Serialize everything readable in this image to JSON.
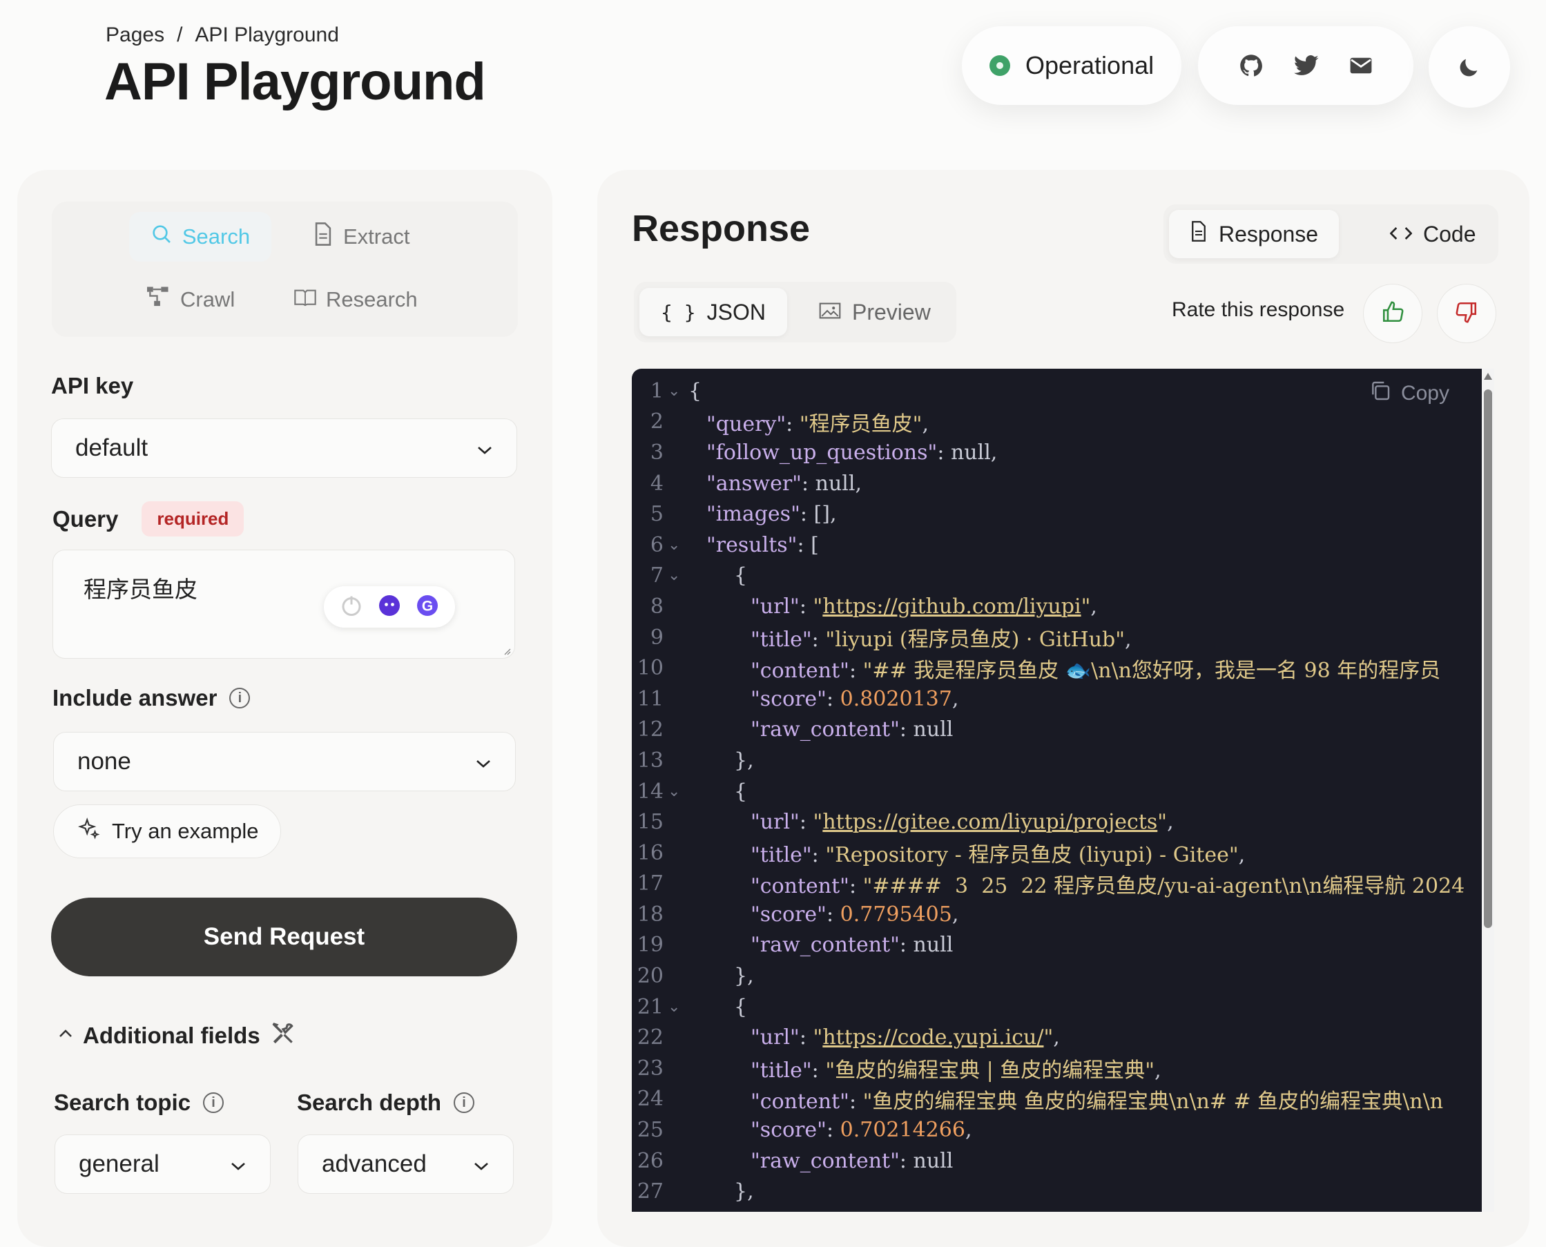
{
  "breadcrumb": {
    "root": "Pages",
    "sep": "/",
    "current": "API Playground"
  },
  "page_title": "API Playground",
  "status": {
    "label": "Operational",
    "color": "#3fa268"
  },
  "social_icons": [
    "github-icon",
    "twitter-icon",
    "mail-icon"
  ],
  "theme_icon": "moon-icon",
  "tabs": {
    "search": "Search",
    "extract": "Extract",
    "crawl": "Crawl",
    "research": "Research"
  },
  "api_key": {
    "label": "API key",
    "value": "default"
  },
  "query": {
    "label": "Query",
    "badge": "required",
    "value": "程序员鱼皮"
  },
  "include_answer": {
    "label": "Include answer",
    "value": "none"
  },
  "try_example": "Try an example",
  "send_request": "Send Request",
  "additional_fields": "Additional fields",
  "search_topic": {
    "label": "Search topic",
    "value": "general"
  },
  "search_depth": {
    "label": "Search depth",
    "value": "advanced"
  },
  "response": {
    "title": "Response",
    "view_response": "Response",
    "view_code": "Code",
    "format_json": "JSON",
    "format_preview": "Preview",
    "rate": "Rate this response",
    "copy": "Copy"
  },
  "code_lines": [
    {
      "n": "1",
      "fold": true,
      "indent": 0,
      "parts": [
        [
          "p",
          "{"
        ]
      ]
    },
    {
      "n": "2",
      "indent": 1,
      "parts": [
        [
          "k",
          "\"query\""
        ],
        [
          "p",
          ": "
        ],
        [
          "s",
          "\"程序员鱼皮\""
        ],
        [
          "p",
          ","
        ]
      ]
    },
    {
      "n": "3",
      "indent": 1,
      "parts": [
        [
          "k",
          "\"follow_up_questions\""
        ],
        [
          "p",
          ": null,"
        ]
      ]
    },
    {
      "n": "4",
      "indent": 1,
      "parts": [
        [
          "k",
          "\"answer\""
        ],
        [
          "p",
          ": null,"
        ]
      ]
    },
    {
      "n": "5",
      "indent": 1,
      "parts": [
        [
          "k",
          "\"images\""
        ],
        [
          "p",
          ": [],"
        ]
      ]
    },
    {
      "n": "6",
      "fold": true,
      "indent": 1,
      "parts": [
        [
          "k",
          "\"results\""
        ],
        [
          "p",
          ": ["
        ]
      ]
    },
    {
      "n": "7",
      "fold": true,
      "indent": 2,
      "parts": [
        [
          "p",
          "{"
        ]
      ]
    },
    {
      "n": "8",
      "indent": 3,
      "parts": [
        [
          "k",
          "\"url\""
        ],
        [
          "p",
          ": "
        ],
        [
          "s",
          "\""
        ],
        [
          "u",
          "https://github.com/liyupi"
        ],
        [
          "s",
          "\""
        ],
        [
          "p",
          ","
        ]
      ]
    },
    {
      "n": "9",
      "indent": 3,
      "parts": [
        [
          "k",
          "\"title\""
        ],
        [
          "p",
          ": "
        ],
        [
          "s",
          "\"liyupi (程序员鱼皮) · GitHub\""
        ],
        [
          "p",
          ","
        ]
      ]
    },
    {
      "n": "10",
      "indent": 3,
      "parts": [
        [
          "k",
          "\"content\""
        ],
        [
          "p",
          ": "
        ],
        [
          "s",
          "\"## 我是程序员鱼皮 🐟\\n\\n您好呀，我是一名 98 年的程序员"
        ]
      ]
    },
    {
      "n": "11",
      "indent": 3,
      "parts": [
        [
          "k",
          "\"score\""
        ],
        [
          "p",
          ": "
        ],
        [
          "n",
          "0.8020137"
        ],
        [
          "p",
          ","
        ]
      ]
    },
    {
      "n": "12",
      "indent": 3,
      "parts": [
        [
          "k",
          "\"raw_content\""
        ],
        [
          "p",
          ": null"
        ]
      ]
    },
    {
      "n": "13",
      "indent": 2,
      "parts": [
        [
          "p",
          "},"
        ]
      ]
    },
    {
      "n": "14",
      "fold": true,
      "indent": 2,
      "parts": [
        [
          "p",
          "{"
        ]
      ]
    },
    {
      "n": "15",
      "indent": 3,
      "parts": [
        [
          "k",
          "\"url\""
        ],
        [
          "p",
          ": "
        ],
        [
          "s",
          "\""
        ],
        [
          "u",
          "https://gitee.com/liyupi/projects"
        ],
        [
          "s",
          "\""
        ],
        [
          "p",
          ","
        ]
      ]
    },
    {
      "n": "16",
      "indent": 3,
      "parts": [
        [
          "k",
          "\"title\""
        ],
        [
          "p",
          ": "
        ],
        [
          "s",
          "\"Repository - 程序员鱼皮 (liyupi) - Gitee\""
        ],
        [
          "p",
          ","
        ]
      ]
    },
    {
      "n": "17",
      "indent": 3,
      "parts": [
        [
          "k",
          "\"content\""
        ],
        [
          "p",
          ": "
        ],
        [
          "s",
          "\"####  3  25  22 程序员鱼皮/yu-ai-agent\\n\\n编程导航 2024"
        ]
      ]
    },
    {
      "n": "18",
      "indent": 3,
      "parts": [
        [
          "k",
          "\"score\""
        ],
        [
          "p",
          ": "
        ],
        [
          "n",
          "0.7795405"
        ],
        [
          "p",
          ","
        ]
      ]
    },
    {
      "n": "19",
      "indent": 3,
      "parts": [
        [
          "k",
          "\"raw_content\""
        ],
        [
          "p",
          ": null"
        ]
      ]
    },
    {
      "n": "20",
      "indent": 2,
      "parts": [
        [
          "p",
          "},"
        ]
      ]
    },
    {
      "n": "21",
      "fold": true,
      "indent": 2,
      "parts": [
        [
          "p",
          "{"
        ]
      ]
    },
    {
      "n": "22",
      "indent": 3,
      "parts": [
        [
          "k",
          "\"url\""
        ],
        [
          "p",
          ": "
        ],
        [
          "s",
          "\""
        ],
        [
          "u",
          "https://code.yupi.icu/"
        ],
        [
          "s",
          "\""
        ],
        [
          "p",
          ","
        ]
      ]
    },
    {
      "n": "23",
      "indent": 3,
      "parts": [
        [
          "k",
          "\"title\""
        ],
        [
          "p",
          ": "
        ],
        [
          "s",
          "\"鱼皮的编程宝典 | 鱼皮的编程宝典\""
        ],
        [
          "p",
          ","
        ]
      ]
    },
    {
      "n": "24",
      "indent": 3,
      "parts": [
        [
          "k",
          "\"content\""
        ],
        [
          "p",
          ": "
        ],
        [
          "s",
          "\"鱼皮的编程宝典 鱼皮的编程宝典\\n\\n# # 鱼皮的编程宝典\\n\\n"
        ]
      ]
    },
    {
      "n": "25",
      "indent": 3,
      "parts": [
        [
          "k",
          "\"score\""
        ],
        [
          "p",
          ": "
        ],
        [
          "n",
          "0.70214266"
        ],
        [
          "p",
          ","
        ]
      ]
    },
    {
      "n": "26",
      "indent": 3,
      "parts": [
        [
          "k",
          "\"raw_content\""
        ],
        [
          "p",
          ": null"
        ]
      ]
    },
    {
      "n": "27",
      "indent": 2,
      "parts": [
        [
          "p",
          "},"
        ]
      ]
    }
  ]
}
